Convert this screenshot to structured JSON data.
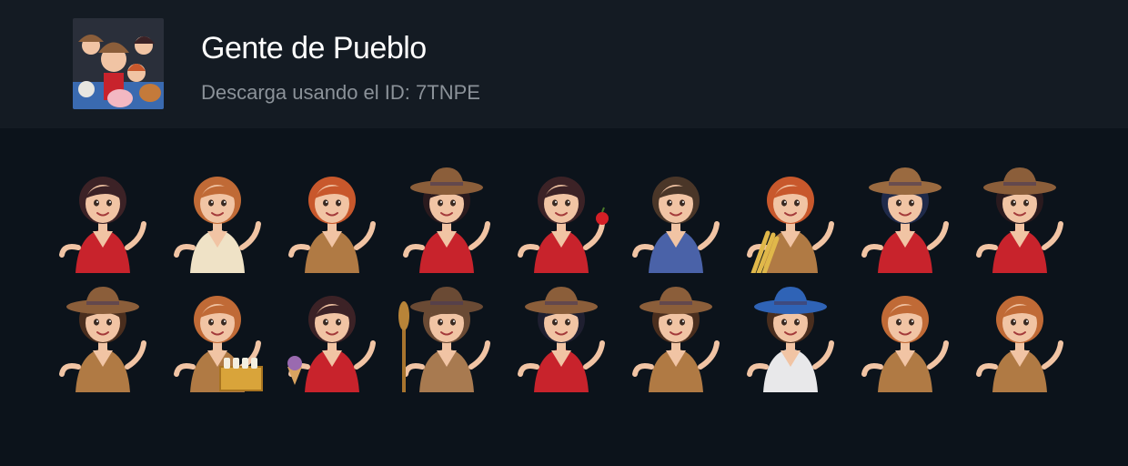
{
  "pack": {
    "title": "Gente de Pueblo",
    "subtitle": "Descarga usando el ID: 7TNPE",
    "thumbnail_icon": "pack-collage-thumbnail"
  },
  "colors": {
    "page_bg": "#0c131b",
    "header_bg": "#141b23",
    "title": "#ffffff",
    "subtitle": "#8b9299",
    "skin": "#f1c4a4",
    "red_dress": "#c8232c",
    "cream_shirt": "#efe2c6",
    "cowboy_hat": "#8b5e3a",
    "auburn_hair": "#c8582c",
    "dark_hair": "#3c2226",
    "brown_vest": "#b07a44",
    "blue_hat": "#2f63b6"
  },
  "stickers": [
    {
      "id": 1,
      "icon": "woman-dark-hair-red-dress",
      "hair": "#3c2226",
      "outfit": "#c8232c",
      "hat": null,
      "prop": null
    },
    {
      "id": 2,
      "icon": "boy-auburn-thumbs-up",
      "hair": "#c06a36",
      "outfit": "#efe2c6",
      "hat": null,
      "prop": null
    },
    {
      "id": 3,
      "icon": "woman-auburn-waving",
      "hair": "#c8582c",
      "outfit": "#b07a44",
      "hat": null,
      "prop": null
    },
    {
      "id": 4,
      "icon": "cowgirl-brown-hat",
      "hair": "#2a1a1e",
      "outfit": "#c8232c",
      "hat": "#8b5e3a",
      "prop": null
    },
    {
      "id": 5,
      "icon": "woman-holding-apple",
      "hair": "#3c2226",
      "outfit": "#c8232c",
      "hat": null,
      "prop": "apple"
    },
    {
      "id": 6,
      "icon": "man-blue-coat-thumbs-up",
      "hair": "#4a3628",
      "outfit": "#4a62a8",
      "hat": null,
      "prop": null
    },
    {
      "id": 7,
      "icon": "woman-wheat-bundle",
      "hair": "#c8582c",
      "outfit": "#b07a44",
      "hat": null,
      "prop": "wheat"
    },
    {
      "id": 8,
      "icon": "cowgirl-pointing",
      "hair": "#1f2a4a",
      "outfit": "#c8232c",
      "hat": "#9a6a40",
      "prop": null
    },
    {
      "id": 9,
      "icon": "cowgirl-shrugging",
      "hair": "#2a1a1e",
      "outfit": "#c8232c",
      "hat": "#8b5e3a",
      "prop": null
    },
    {
      "id": 10,
      "icon": "cowboy-blue-band-hat",
      "hair": "#4a2e1e",
      "outfit": "#b07a44",
      "hat": "#8b5e3a",
      "prop": null
    },
    {
      "id": 11,
      "icon": "woman-milk-crate",
      "hair": "#c06a36",
      "outfit": "#b07a44",
      "hat": null,
      "prop": "crate"
    },
    {
      "id": 12,
      "icon": "woman-ice-cream",
      "hair": "#3c2226",
      "outfit": "#c8232c",
      "hat": null,
      "prop": "icecream"
    },
    {
      "id": 13,
      "icon": "trapper-fur-hat-paddle",
      "hair": "#6a4a34",
      "outfit": "#a87a50",
      "hat": "#6a4a34",
      "prop": "paddle"
    },
    {
      "id": 14,
      "icon": "cowgirl-big-hat",
      "hair": "#1f1f30",
      "outfit": "#c8232c",
      "hat": "#8b5e3a",
      "prop": null
    },
    {
      "id": 15,
      "icon": "cowboy-pointing-up",
      "hair": "#4a2e1e",
      "outfit": "#b07a44",
      "hat": "#8b5e3a",
      "prop": null
    },
    {
      "id": 16,
      "icon": "sheriff-blue-hat-mustache",
      "hair": "#4a2e1e",
      "outfit": "#e8e8ea",
      "hat": "#2f63b6",
      "prop": null
    },
    {
      "id": 17,
      "icon": "woman-auburn-thinking",
      "hair": "#c06a36",
      "outfit": "#b07a44",
      "hat": null,
      "prop": null
    },
    {
      "id": 18,
      "icon": "woman-auburn-presenting",
      "hair": "#c06a36",
      "outfit": "#b07a44",
      "hat": null,
      "prop": null
    }
  ]
}
